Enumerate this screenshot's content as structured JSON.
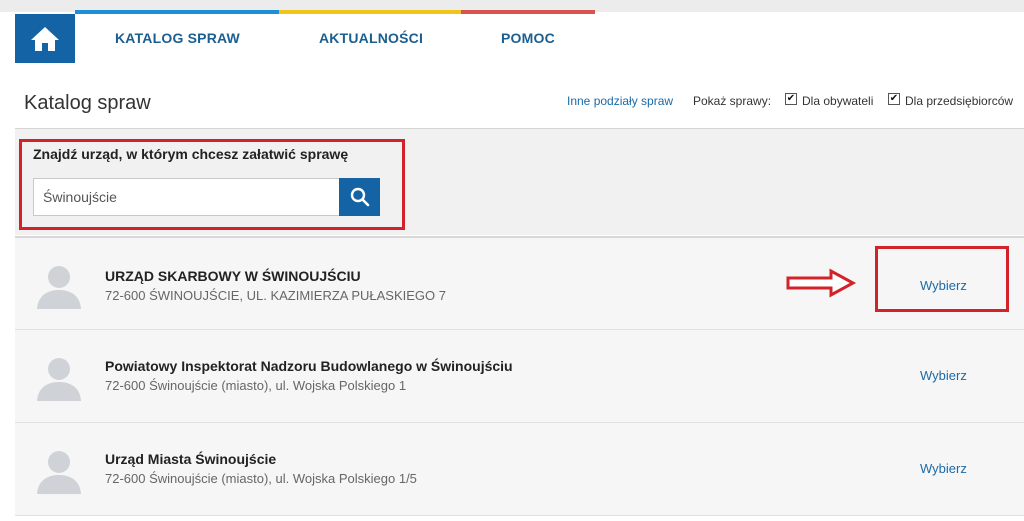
{
  "header": {
    "home_icon": "home-icon",
    "nav": [
      {
        "label": "KATALOG SPRAW"
      },
      {
        "label": "AKTUALNOŚCI"
      },
      {
        "label": "POMOC"
      }
    ],
    "accent_colors": [
      "#1d8fd6",
      "#f0c419",
      "#d9534f"
    ],
    "brand_color": "#1463a5"
  },
  "page": {
    "title": "Katalog spraw",
    "other_link": "Inne podziały spraw",
    "show_label": "Pokaż sprawy:",
    "filters": [
      {
        "label": "Dla obywateli",
        "checked": true
      },
      {
        "label": "Dla przedsiębiorców",
        "checked": true
      }
    ]
  },
  "search": {
    "label": "Znajdź urząd, w którym chcesz załatwić sprawę",
    "value": "Świnoujście",
    "icon": "search-icon"
  },
  "offices": [
    {
      "name": "URZĄD SKARBOWY W ŚWINOUJŚCIU",
      "address": "72-600 ŚWINOUJŚCIE, UL. KAZIMIERZA PUŁASKIEGO 7",
      "action": "Wybierz"
    },
    {
      "name": "Powiatowy Inspektorat Nadzoru Budowlanego w Świnoujściu",
      "address": "72-600 Świnoujście (miasto), ul. Wojska Polskiego 1",
      "action": "Wybierz"
    },
    {
      "name": "Urząd Miasta Świnoujście",
      "address": "72-600 Świnoujście (miasto), ul. Wojska Polskiego 1/5",
      "action": "Wybierz"
    }
  ],
  "annotation_color": "#d2232a"
}
